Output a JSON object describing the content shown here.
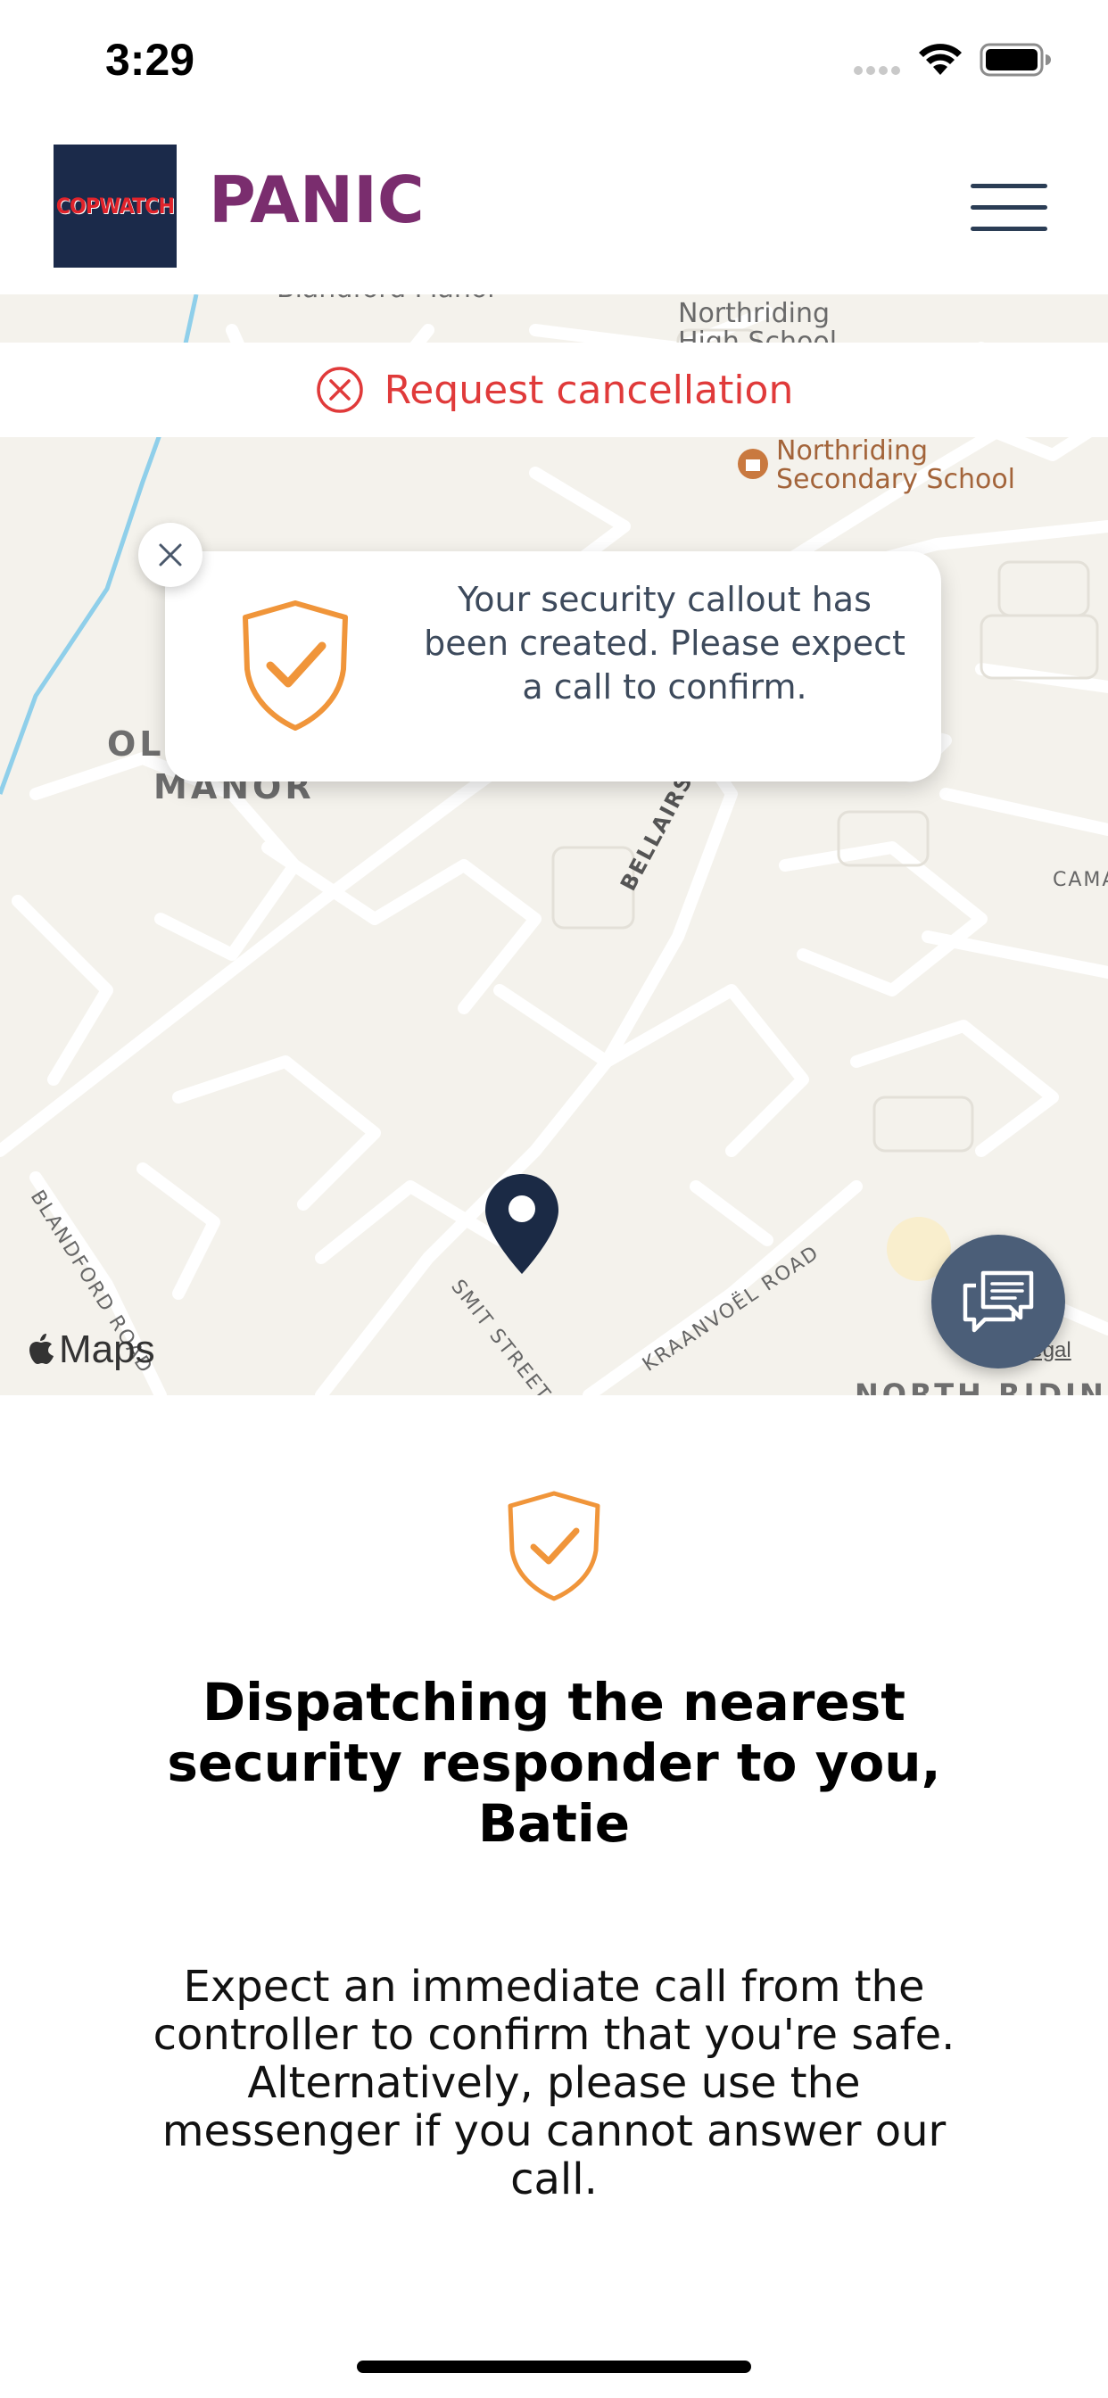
{
  "status_bar": {
    "time": "3:29"
  },
  "header": {
    "logo_text": "COPWATCH",
    "title": "PANIC"
  },
  "map": {
    "labels": {
      "blandford_manor": "Blandford Manor",
      "northriding_high": "Northriding High School",
      "northriding_secondary_1": "Northriding",
      "northriding_secondary_2": "Secondary School",
      "oli": "OLI",
      "manor": "MANOR",
      "bellairs_drive": "BELLAIRS DRIVE",
      "cama": "CAMA",
      "blandford_road": "BLANDFORD ROAD",
      "smit_street": "SMIT STREET",
      "kraanvoel_road": "KRAANVOËL ROAD",
      "north_riding": "NORTH RIDIN"
    },
    "attribution": "Maps",
    "legal": "Legal"
  },
  "cancel": {
    "label": "Request cancellation"
  },
  "toast": {
    "message": "Your security callout has been created. Please expect a call to confirm."
  },
  "content": {
    "headline": "Dispatching the nearest security responder to you, Batie",
    "body": "Expect an immediate call from the controller to confirm that you're safe. Alternatively, please use the messenger if you cannot answer our call."
  },
  "colors": {
    "brand_purple": "#7a2d6e",
    "alert_red": "#e03a3a",
    "shield_orange": "#f0953a",
    "pin_navy": "#1b2a45",
    "chat_slate": "#4b5e78"
  },
  "icons": {
    "menu": "hamburger-icon",
    "cancel": "close-circle-icon",
    "shield": "shield-check-icon",
    "close": "close-icon",
    "pin": "map-pin-icon",
    "chat": "chat-bubbles-icon"
  }
}
